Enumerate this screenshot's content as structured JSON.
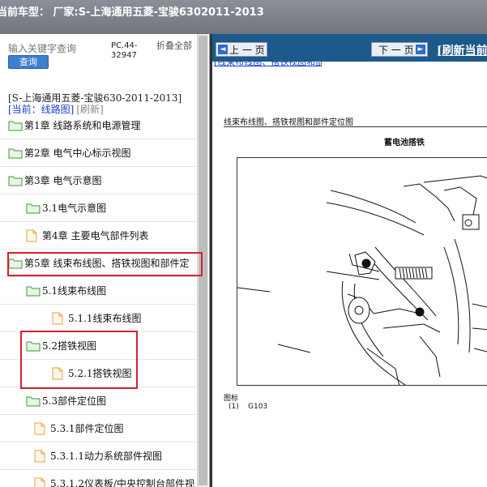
{
  "titlebar": {
    "text": "当前车型：  厂家:S-上海通用五菱-宝骏6302011-2013"
  },
  "sidebar": {
    "search": {
      "placeholder": "输入关键字查询",
      "button": "查询"
    },
    "pc_code": "PC.44-32947",
    "fold_all": "折叠全部",
    "model_line": "[S-上海通用五菱-宝骏630-2011-2013]",
    "current": {
      "label": "[当前：线路图]",
      "refresh": "[刷新]"
    },
    "tree": [
      {
        "label": "第1章 线路系统和电源管理",
        "type": "folder"
      },
      {
        "label": "第2章 电气中心标示视图",
        "type": "folder"
      },
      {
        "label": "第3章 电气示意图",
        "type": "folder"
      },
      {
        "label": "3.1电气示意图",
        "type": "folder"
      },
      {
        "label": "第4章 主要电气部件列表",
        "type": "file"
      },
      {
        "label": "第5章 线束布线图、搭铁视图和部件定",
        "type": "folder"
      },
      {
        "label": "5.1线束布线图",
        "type": "folder"
      },
      {
        "label": "5.1.1线束布线图",
        "type": "file"
      },
      {
        "label": "5.2搭铁视图",
        "type": "folder"
      },
      {
        "label": "5.2.1搭铁视图",
        "type": "file"
      },
      {
        "label": "5.3部件定位图",
        "type": "folder"
      },
      {
        "label": "5.3.1部件定位图",
        "type": "file"
      },
      {
        "label": "5.3.1.1动力系统部件视图",
        "type": "file"
      },
      {
        "label": "5.3.1.2仪表板/中央控制台部件视",
        "type": "file"
      }
    ]
  },
  "content": {
    "nav": {
      "prev": "上 一 页",
      "next": "下 一 页",
      "refresh_link": "[刷新当前"
    },
    "doc_title": "线束布线图、搭铁视图和部件定位图",
    "doc_subtitle": "蓄电池搭铁",
    "legend_header": "图标",
    "legend_items": [
      {
        "num": "(1)",
        "value": "G103"
      }
    ]
  },
  "colors": {
    "highlight": "#d9202c",
    "nav_bg": "#1c5a8c",
    "folder": "#3a9a3a",
    "file": "#e8a040"
  }
}
